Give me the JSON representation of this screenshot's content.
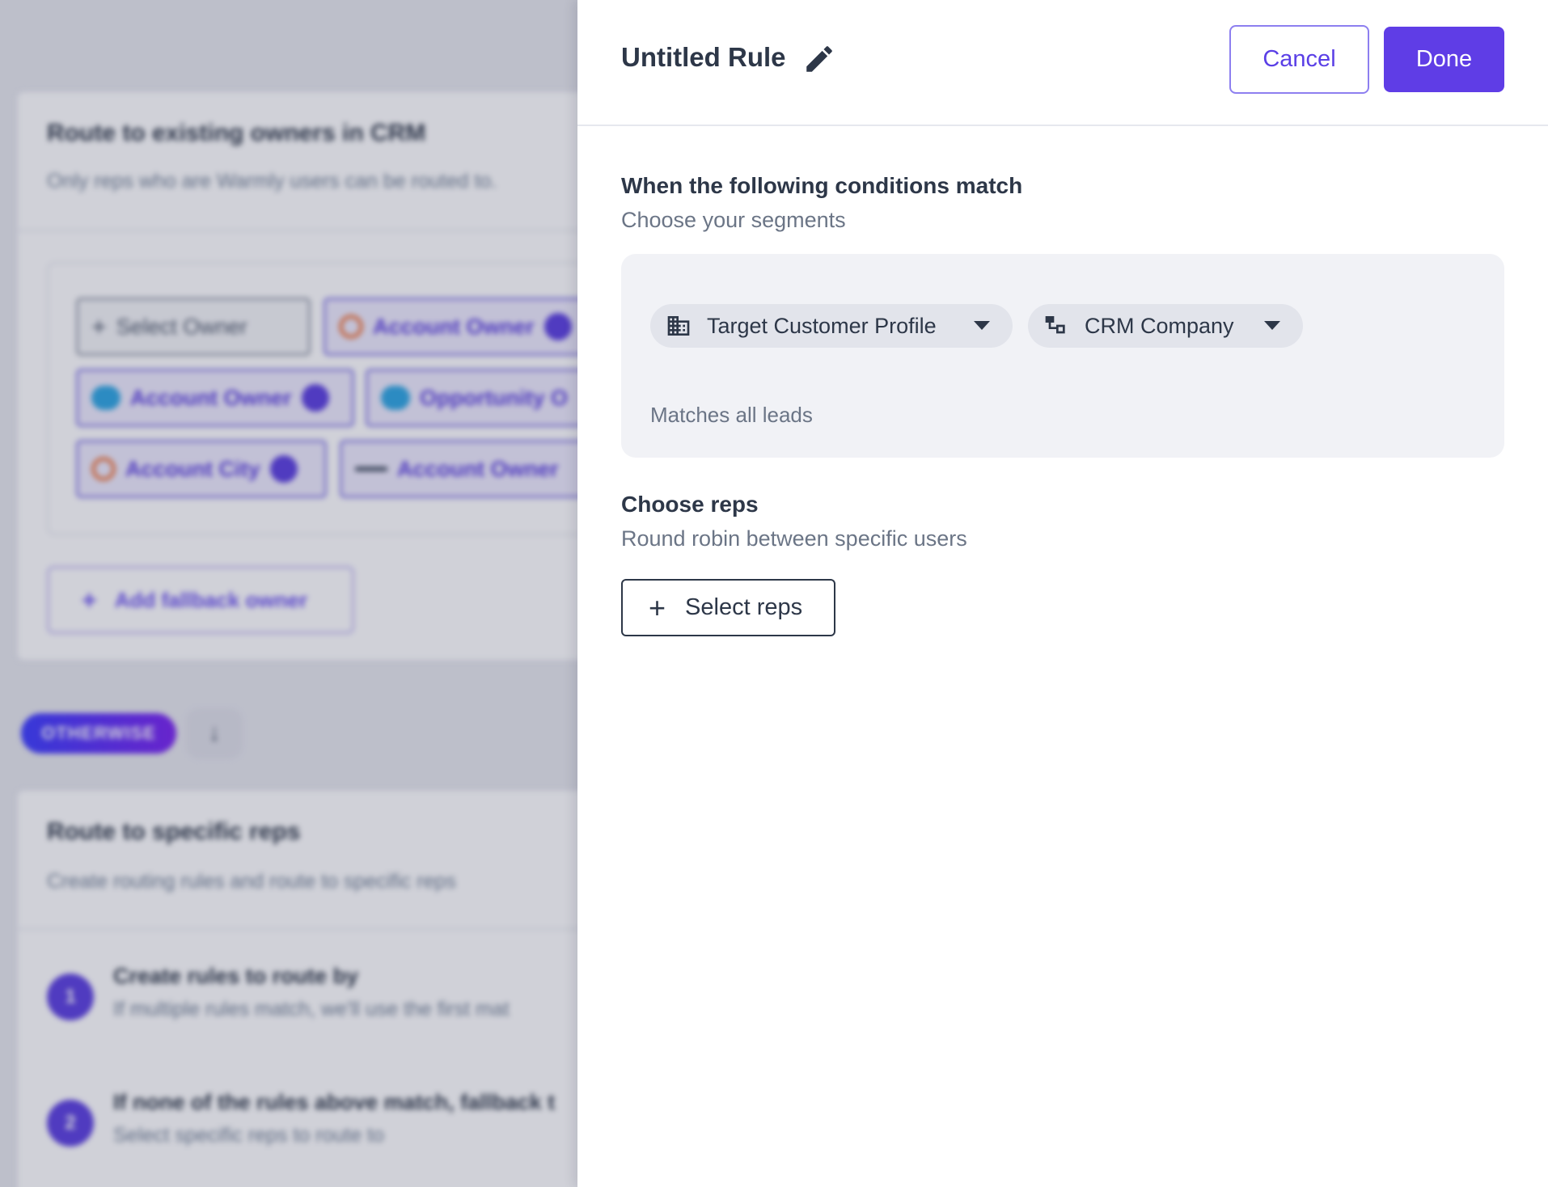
{
  "background": {
    "card1": {
      "title": "Route to existing owners in CRM",
      "subtitle": "Only reps who are Warmly users can be routed to.",
      "chips": [
        {
          "label": "Select Owner",
          "icon": "plus-icon"
        },
        {
          "label": "Account Owner",
          "icon": "hubspot-icon"
        },
        {
          "label": "Account Owner",
          "icon": "salesforce-icon"
        },
        {
          "label": "Opportunity O",
          "icon": "salesforce-icon"
        },
        {
          "label": "Account City",
          "icon": "hubspot-icon"
        },
        {
          "label": "Account Owner",
          "icon": "dash-icon"
        }
      ],
      "fallback_label": "Add fallback owner"
    },
    "otherwise_label": "OTHERWISE",
    "card2": {
      "title": "Route to specific reps",
      "subtitle": "Create routing rules and route to specific reps",
      "steps": [
        {
          "number": "1",
          "title": "Create rules to route by",
          "subtitle": "If multiple rules match, we'll use the first mat"
        },
        {
          "number": "2",
          "title": "If none of the rules above match, fallback t",
          "subtitle": "Select specific reps to route to"
        }
      ]
    }
  },
  "drawer": {
    "title": "Untitled Rule",
    "cancel_label": "Cancel",
    "done_label": "Done",
    "conditions": {
      "title": "When the following conditions match",
      "subtitle": "Choose your segments",
      "segments": [
        {
          "label": "Target Customer Profile",
          "icon": "building-icon"
        },
        {
          "label": "CRM Company",
          "icon": "org-chart-icon"
        }
      ],
      "matches_text": "Matches all leads"
    },
    "reps": {
      "title": "Choose reps",
      "subtitle": "Round robin between specific users",
      "select_label": "Select reps"
    }
  },
  "colors": {
    "accent": "#5f3de6",
    "text": "#2d3748",
    "muted": "#6b7586",
    "panel": "#f1f2f6"
  }
}
